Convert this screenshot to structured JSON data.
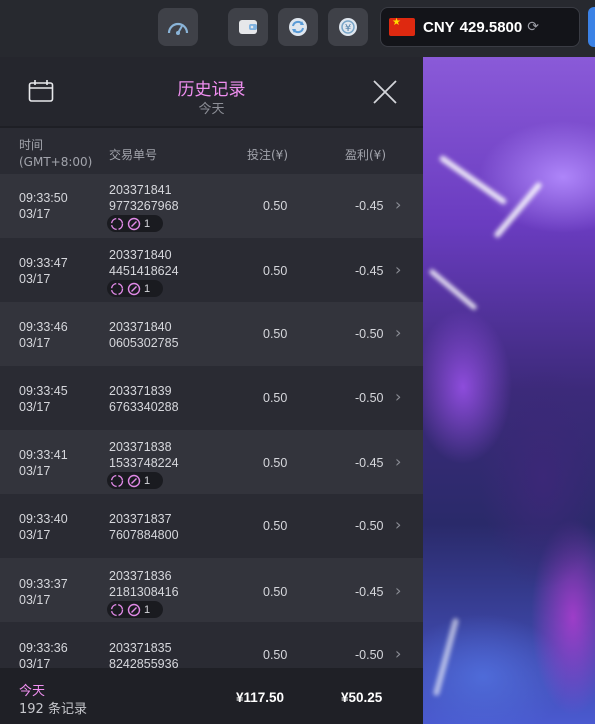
{
  "topbar": {
    "icons": [
      "speedometer-icon",
      "wallet-icon",
      "swap-icon",
      "currency-icon"
    ],
    "balance": {
      "currency": "CNY",
      "amount": "429.5800",
      "flag": "china-flag-icon",
      "refresh_icon": "⟳"
    }
  },
  "panel": {
    "title": "历史记录",
    "subtitle": "今天",
    "calendar_icon": "calendar-icon",
    "close_icon": "close-icon",
    "columns": {
      "time": "时间",
      "timezone": "(GMT+8:00)",
      "order": "交易单号",
      "bet": "投注(¥)",
      "profit": "盈利(¥)"
    },
    "rows": [
      {
        "time": "09:33:50",
        "date": "03/17",
        "order1": "203371841",
        "order2": "9773267968",
        "bet": "0.50",
        "profit": "-0.45",
        "badge": "1",
        "chevron": "›"
      },
      {
        "time": "09:33:47",
        "date": "03/17",
        "order1": "203371840",
        "order2": "4451418624",
        "bet": "0.50",
        "profit": "-0.45",
        "badge": "1",
        "chevron": "›"
      },
      {
        "time": "09:33:46",
        "date": "03/17",
        "order1": "203371840",
        "order2": "0605302785",
        "bet": "0.50",
        "profit": "-0.50",
        "badge": null,
        "chevron": "›"
      },
      {
        "time": "09:33:45",
        "date": "03/17",
        "order1": "203371839",
        "order2": "6763340288",
        "bet": "0.50",
        "profit": "-0.50",
        "badge": null,
        "chevron": "›"
      },
      {
        "time": "09:33:41",
        "date": "03/17",
        "order1": "203371838",
        "order2": "1533748224",
        "bet": "0.50",
        "profit": "-0.45",
        "badge": "1",
        "chevron": "›"
      },
      {
        "time": "09:33:40",
        "date": "03/17",
        "order1": "203371837",
        "order2": "7607884800",
        "bet": "0.50",
        "profit": "-0.50",
        "badge": null,
        "chevron": "›"
      },
      {
        "time": "09:33:37",
        "date": "03/17",
        "order1": "203371836",
        "order2": "2181308416",
        "bet": "0.50",
        "profit": "-0.45",
        "badge": "1",
        "chevron": "›"
      },
      {
        "time": "09:33:36",
        "date": "03/17",
        "order1": "203371835",
        "order2": "8242855936",
        "bet": "0.50",
        "profit": "-0.50",
        "badge": null,
        "chevron": "›"
      }
    ],
    "footer": {
      "label": "今天",
      "count": "192 条记录",
      "total_bet": "¥117.50",
      "total_profit": "¥50.25"
    }
  },
  "colors": {
    "accent_pink": "#f08ff0",
    "panel_bg": "#2a2b33",
    "row_alt": "#33343c",
    "balance_edge": "#3b82e6"
  }
}
